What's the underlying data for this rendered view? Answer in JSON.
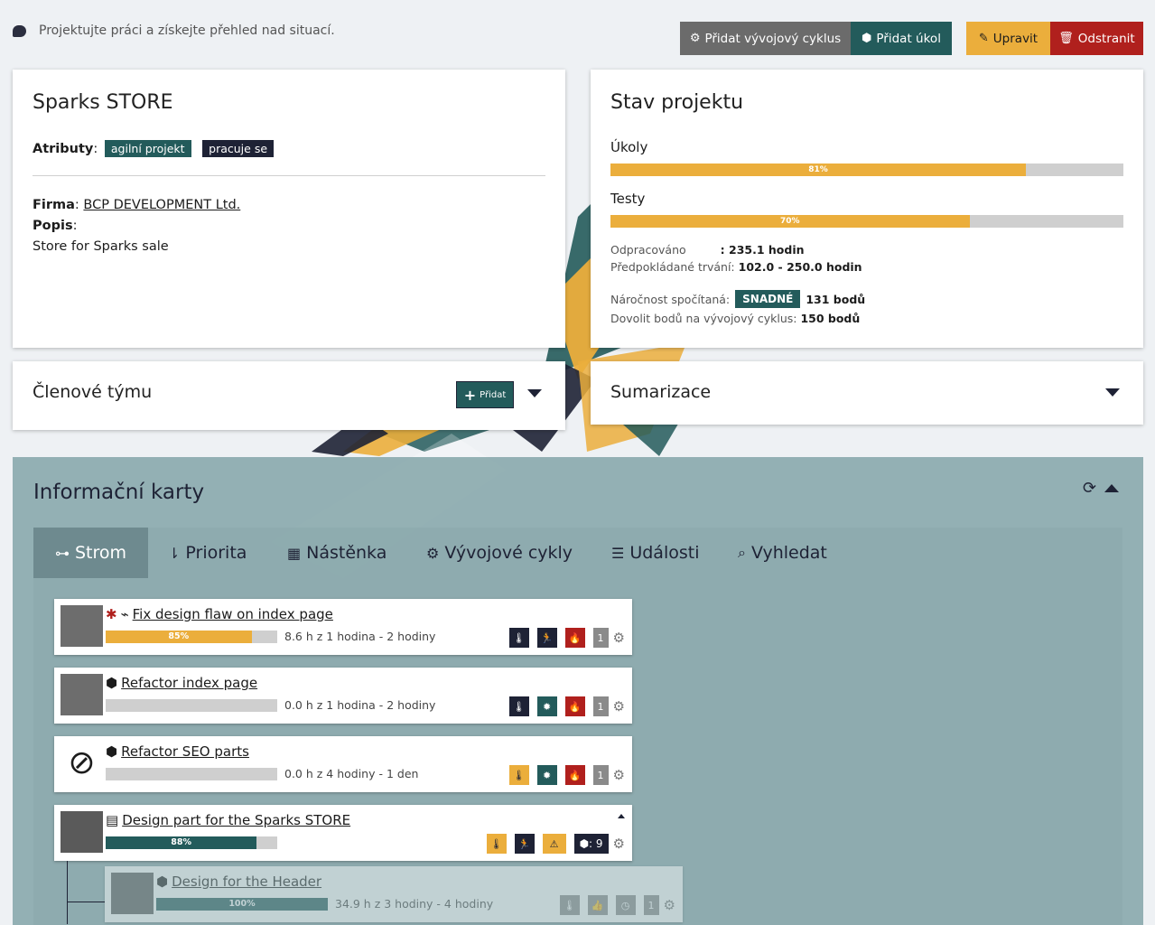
{
  "header": {
    "tagline": "Projektujte práci a získejte přehled nad situací.",
    "buttons": {
      "add_cycle": "Přidat vývojový cyklus",
      "add_task": "Přidat úkol",
      "edit": "Upravit",
      "delete": "Odstranit"
    }
  },
  "project": {
    "name": "Sparks STORE",
    "attributes_label": "Atributy",
    "attributes": [
      "agilní projekt",
      "pracuje se"
    ],
    "company_label": "Firma",
    "company": "BCP DEVELOPMENT Ltd.",
    "description_label": "Popis",
    "description": "Store for Sparks sale"
  },
  "status": {
    "title": "Stav projektu",
    "tasks_label": "Úkoly",
    "tasks_progress": 81,
    "tasks_progress_text": "81%",
    "tests_label": "Testy",
    "tests_progress": 70,
    "tests_progress_text": "70%",
    "worked_label": "Odpracováno",
    "worked_value": ": 235.1 hodin",
    "expected_label": "Předpokládané trvání:",
    "expected_value": "102.0 - 250.0 hodin",
    "difficulty_label": "Náročnost spočítaná:",
    "difficulty_badge": "SNADNÉ",
    "difficulty_points": "131 bodů",
    "allow_label": "Dovolit bodů na vývojový cyklus:",
    "allow_value": "150 bodů"
  },
  "team": {
    "title": "Členové týmu",
    "add_label": "Přidat"
  },
  "summary": {
    "title": "Sumarizace"
  },
  "info": {
    "title": "Informační karty",
    "tabs": [
      {
        "label": "Strom",
        "icon": "sitemap-icon"
      },
      {
        "label": "Priorita",
        "icon": "sort-icon"
      },
      {
        "label": "Nástěnka",
        "icon": "grid-icon"
      },
      {
        "label": "Vývojové cykly",
        "icon": "cogs-icon"
      },
      {
        "label": "Události",
        "icon": "list-icon"
      },
      {
        "label": "Vyhledat",
        "icon": "search-icon"
      }
    ],
    "tasks": [
      {
        "title": "Fix design flaw on index page",
        "progress": 85,
        "progress_text": "85%",
        "time": "8.6 h z 1 hodina - 2 hodiny",
        "counter": "1"
      },
      {
        "title": "Refactor index page",
        "progress": 0,
        "progress_text": "",
        "time": "0.0 h z 1 hodina - 2 hodiny",
        "counter": "1"
      },
      {
        "title": "Refactor SEO parts",
        "progress": 0,
        "progress_text": "",
        "time": "0.0 h z 4 hodiny - 1 den",
        "counter": "1"
      },
      {
        "title": "Design part for the Sparks STORE",
        "progress": 88,
        "progress_text": "88%",
        "time": "",
        "counter": ": 9"
      },
      {
        "title": "Design for the Header",
        "progress": 100,
        "progress_text": "100%",
        "time": "34.9 h z 3 hodiny - 4 hodiny",
        "counter": "1"
      }
    ]
  },
  "colors": {
    "yellow": "#ebae3c",
    "teal": "#235b5b",
    "dark": "#1e2235",
    "red": "#b0201d"
  }
}
